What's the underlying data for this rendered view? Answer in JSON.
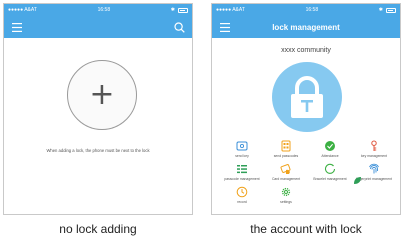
{
  "left": {
    "status": {
      "carrier": "●●●●● A&AT",
      "time": "16:58"
    },
    "hint": "When adding a lock, the phone must be next to the lock",
    "caption": "no lock adding"
  },
  "right": {
    "status": {
      "carrier": "●●●●● A&AT",
      "time": "16:58"
    },
    "title": "lock management",
    "community": "xxxx community",
    "menu": [
      {
        "label": "send key",
        "icon": "send-key-icon",
        "color": "#3a8fd8"
      },
      {
        "label": "send passcodes",
        "icon": "send-passcodes-icon",
        "color": "#f0a21b"
      },
      {
        "label": "Attendance",
        "icon": "attendance-icon",
        "color": "#3cb043"
      },
      {
        "label": "key management",
        "icon": "key-management-icon",
        "color": "#e0563e"
      },
      {
        "label": "passcode management",
        "icon": "passcode-management-icon",
        "color": "#2e9e57"
      },
      {
        "label": "Card management",
        "icon": "card-management-icon",
        "color": "#f0a21b"
      },
      {
        "label": "Bracelet management",
        "icon": "bracelet-management-icon",
        "color": "#3cb043"
      },
      {
        "label": "fingerprint management",
        "icon": "fingerprint-icon",
        "color": "#3a8fd8"
      },
      {
        "label": "record",
        "icon": "record-icon",
        "color": "#f0a21b"
      },
      {
        "label": "settings",
        "icon": "settings-icon",
        "color": "#3cb043"
      }
    ],
    "caption": "the account with lock"
  },
  "colors": {
    "nav": "#4aa8e6",
    "lock_circle": "#86c9f0"
  }
}
